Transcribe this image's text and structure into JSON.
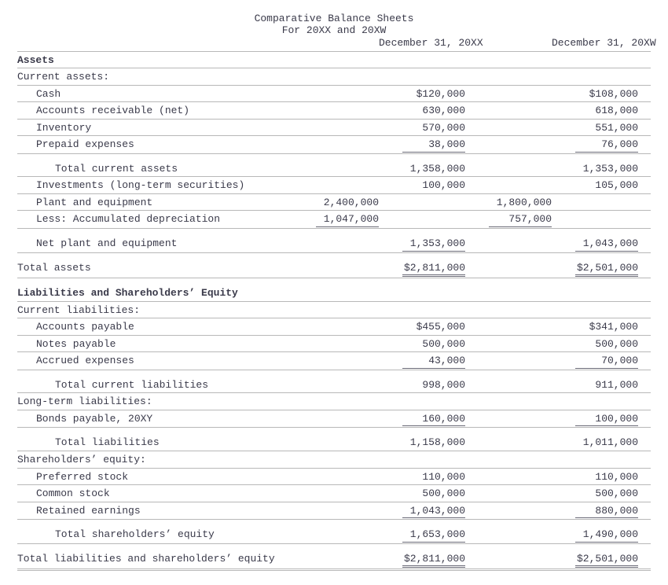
{
  "title": "Comparative Balance Sheets",
  "subtitle": "For 20XX and 20XW",
  "col_headers": {
    "a": "December 31, 20XX",
    "b": "December 31, 20XW"
  },
  "sections": {
    "assets_header": "Assets",
    "current_assets_label": "Current assets:",
    "cash": {
      "label": "Cash",
      "a": "$120,000",
      "b": "$108,000"
    },
    "ar": {
      "label": "Accounts receivable (net)",
      "a": "630,000",
      "b": "618,000"
    },
    "inventory": {
      "label": "Inventory",
      "a": "570,000",
      "b": "551,000"
    },
    "prepaid": {
      "label": "Prepaid expenses",
      "a": "38,000",
      "b": "76,000"
    },
    "total_current_assets": {
      "label": "Total current assets",
      "a": "1,358,000",
      "b": "1,353,000"
    },
    "investments": {
      "label": "Investments (long-term securities)",
      "a": "100,000",
      "b": "105,000"
    },
    "plant_equipment": {
      "label": "Plant and equipment",
      "a_sub": "2,400,000",
      "b_sub": "1,800,000"
    },
    "less_depr": {
      "label": "Less: Accumulated depreciation",
      "a_sub": "1,047,000",
      "b_sub": "757,000"
    },
    "net_plant": {
      "label": "Net plant and equipment",
      "a": "1,353,000",
      "b": "1,043,000"
    },
    "total_assets": {
      "label": "Total assets",
      "a": "$2,811,000",
      "b": "$2,501,000"
    },
    "liab_eq_header": "Liabilities and Shareholders’ Equity",
    "current_liab_label": "Current liabilities:",
    "ap": {
      "label": "Accounts payable",
      "a": "$455,000",
      "b": "$341,000"
    },
    "notes_payable": {
      "label": "Notes payable",
      "a": "500,000",
      "b": "500,000"
    },
    "accrued": {
      "label": "Accrued expenses",
      "a": "43,000",
      "b": "70,000"
    },
    "total_current_liab": {
      "label": "Total current liabilities",
      "a": "998,000",
      "b": "911,000"
    },
    "longterm_label": "Long-term liabilities:",
    "bonds": {
      "label": "Bonds payable, 20XY",
      "a": "160,000",
      "b": "100,000"
    },
    "total_liab": {
      "label": "Total liabilities",
      "a": "1,158,000",
      "b": "1,011,000"
    },
    "se_label": "Shareholders’ equity:",
    "preferred": {
      "label": "Preferred stock",
      "a": "110,000",
      "b": "110,000"
    },
    "common": {
      "label": "Common stock",
      "a": "500,000",
      "b": "500,000"
    },
    "retained": {
      "label": "Retained earnings",
      "a": "1,043,000",
      "b": "880,000"
    },
    "total_se": {
      "label": "Total shareholders’ equity",
      "a": "1,653,000",
      "b": "1,490,000"
    },
    "total_liab_se": {
      "label": "Total liabilities and shareholders’ equity",
      "a": "$2,811,000",
      "b": "$2,501,000"
    }
  }
}
